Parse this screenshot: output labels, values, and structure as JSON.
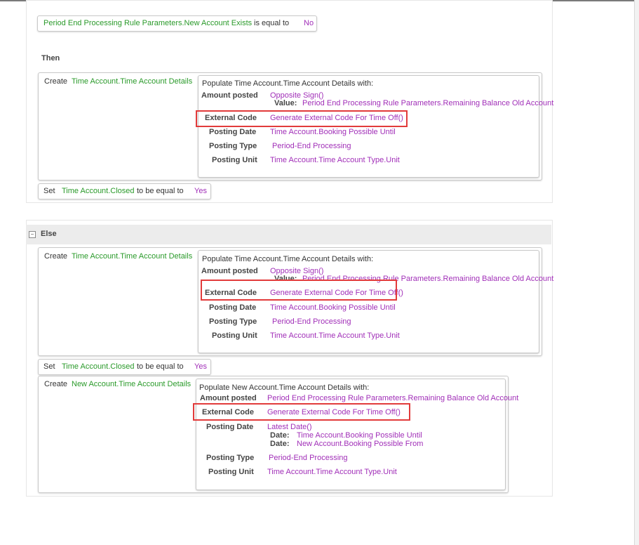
{
  "condition": {
    "field": "Period End Processing Rule Parameters.New Account Exists",
    "operator": "is equal to",
    "value": "No"
  },
  "then": {
    "label": "Then",
    "create": {
      "keyword": "Create",
      "target": "Time Account.Time Account Details",
      "populate_title": "Populate Time Account.Time Account Details with:",
      "amount_label": "Amount posted",
      "amount_fn": "Opposite Sign()",
      "value_label": "Value:",
      "value_text": "Period End Processing Rule Parameters.Remaining Balance Old Account",
      "external_code_label": "External Code",
      "external_code_value": "Generate External Code For Time Off()",
      "posting_date_label": "Posting Date",
      "posting_date_value": "Time Account.Booking Possible Until",
      "posting_type_label": "Posting Type",
      "posting_type_value": "Period-End Processing",
      "posting_unit_label": "Posting Unit",
      "posting_unit_value": "Time Account.Time Account Type.Unit"
    },
    "set": {
      "keyword": "Set",
      "target": "Time Account.Closed",
      "operator": "to be equal to",
      "value": "Yes"
    }
  },
  "else": {
    "label": "Else",
    "toggle": "−",
    "create": {
      "keyword": "Create",
      "target": "Time Account.Time Account Details",
      "populate_title": "Populate Time Account.Time Account Details with:",
      "amount_label": "Amount posted",
      "amount_fn": "Opposite Sign()",
      "value_label": "Value:",
      "value_text": "Period End Processing Rule Parameters.Remaining Balance Old Account",
      "external_code_label": "External Code",
      "external_code_value": "Generate External Code For Time Off()",
      "posting_date_label": "Posting Date",
      "posting_date_value": "Time Account.Booking Possible Until",
      "posting_type_label": "Posting Type",
      "posting_type_value": "Period-End Processing",
      "posting_unit_label": "Posting Unit",
      "posting_unit_value": "Time Account.Time Account Type.Unit"
    },
    "set": {
      "keyword": "Set",
      "target": "Time Account.Closed",
      "operator": "to be equal to",
      "value": "Yes"
    },
    "create_new": {
      "keyword": "Create",
      "target": "New Account.Time Account Details",
      "populate_title": "Populate New Account.Time Account Details with:",
      "amount_label": "Amount posted",
      "amount_value": "Period End Processing Rule Parameters.Remaining Balance Old Account",
      "external_code_label": "External Code",
      "external_code_value": "Generate External Code For Time Off()",
      "posting_date_label": "Posting Date",
      "posting_date_fn": "Latest Date()",
      "date1_label": "Date:",
      "date1_value": "Time Account.Booking Possible Until",
      "date2_label": "Date:",
      "date2_value": "New Account.Booking Possible From",
      "posting_type_label": "Posting Type",
      "posting_type_value": "Period-End Processing",
      "posting_unit_label": "Posting Unit",
      "posting_unit_value": "Time Account.Time Account Type.Unit"
    }
  }
}
